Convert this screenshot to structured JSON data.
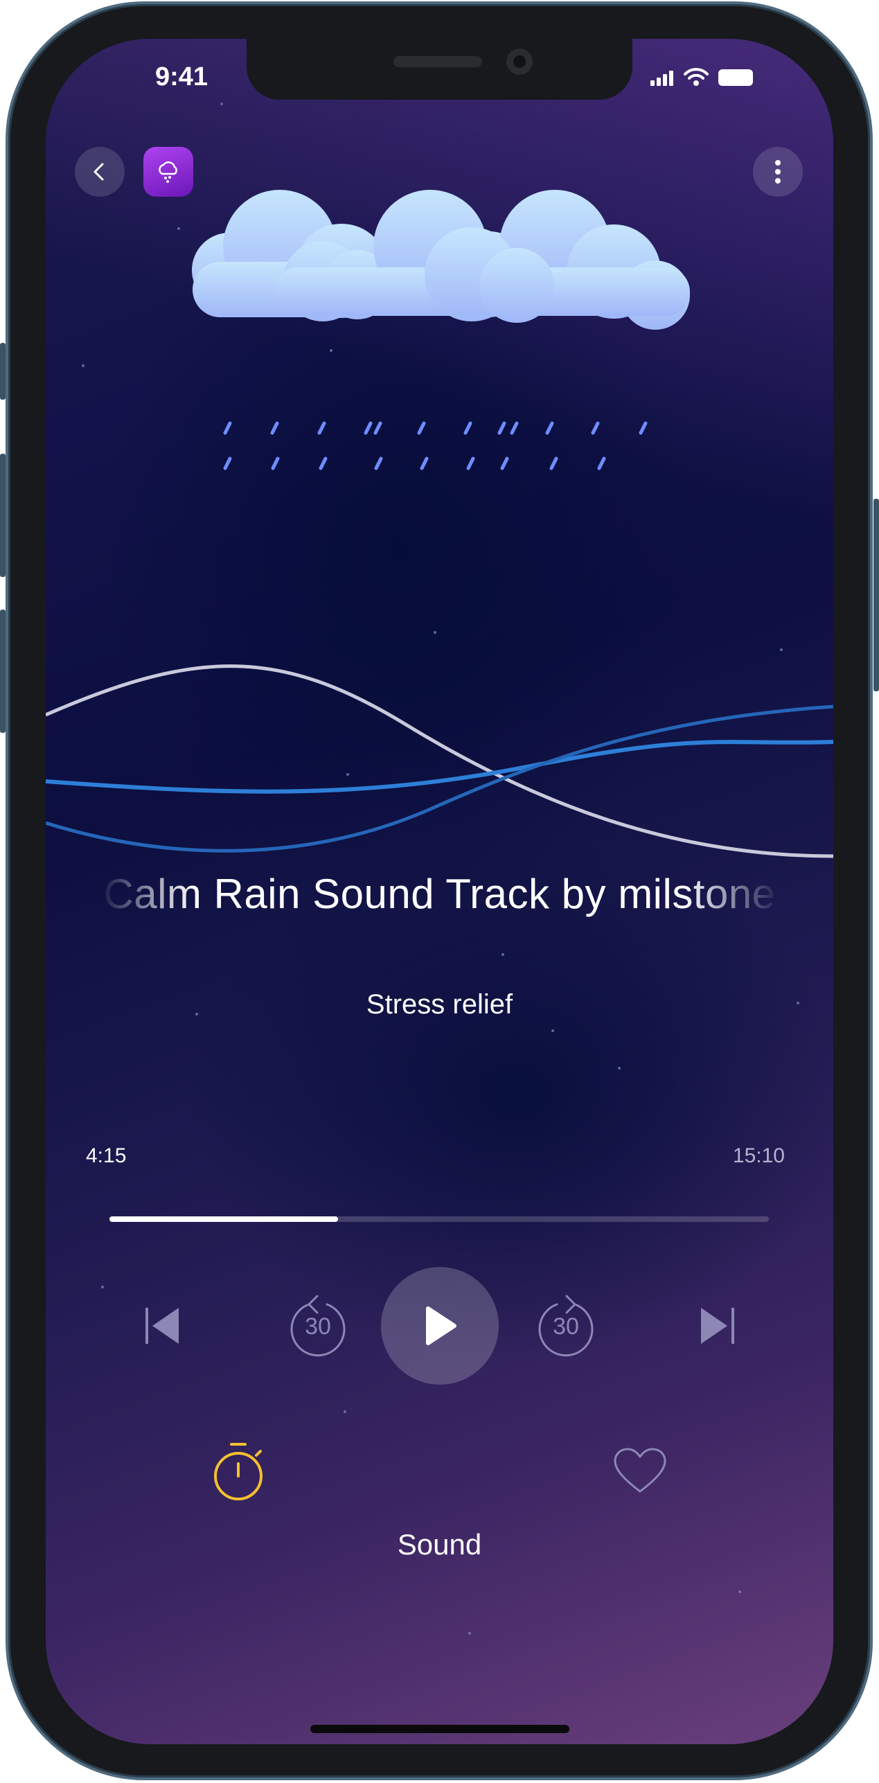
{
  "status_bar": {
    "time": "9:41",
    "signal_icon": "signal-icon",
    "wifi_icon": "wifi-icon",
    "battery_icon": "battery-icon"
  },
  "header": {
    "back_icon": "chevron-left-icon",
    "app_icon": "rain-cloud-icon",
    "more_icon": "more-vertical-icon"
  },
  "track": {
    "title": "Calm Rain Sound Track by milstone",
    "category": "Stress relief"
  },
  "playback": {
    "current_time": "4:15",
    "total_time": "15:10",
    "progress": 0.347
  },
  "controls": {
    "previous_icon": "skip-previous-icon",
    "rewind_icon": "rewind-30-icon",
    "rewind_label": "30",
    "play_icon": "play-icon",
    "forward_icon": "forward-30-icon",
    "forward_label": "30",
    "next_icon": "skip-next-icon"
  },
  "bottom": {
    "timer_icon": "timer-icon",
    "favorite_icon": "heart-icon",
    "label": "Sound"
  },
  "colors": {
    "accent": "#f5c030",
    "wave_white": "#c9c9dc",
    "wave_blue": "#2d7fd8",
    "cloud": "#a9d0fb",
    "rain": "#6f8dff"
  }
}
